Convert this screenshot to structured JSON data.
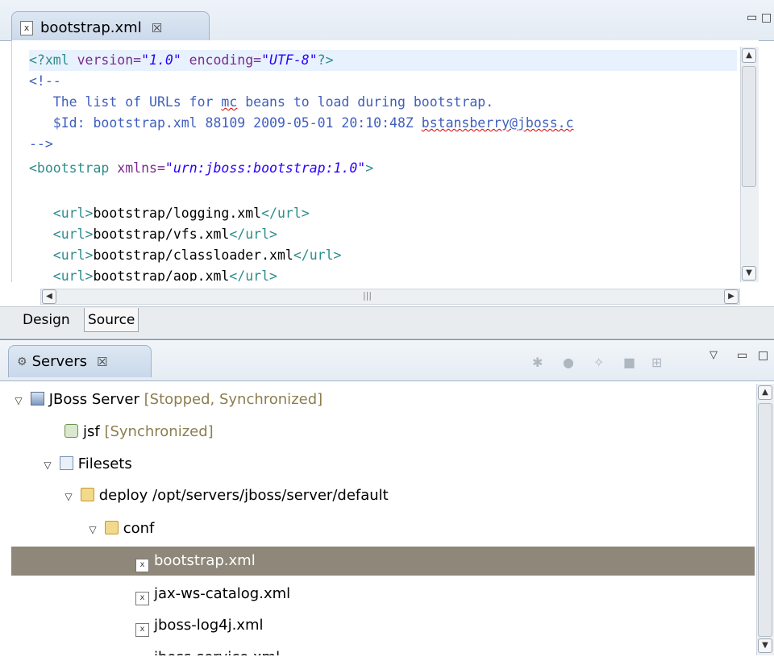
{
  "editor": {
    "tab_title": "bootstrap.xml",
    "tab_icon": "x",
    "close_glyph": "☒",
    "lines": {
      "l1_decl_open": "<?xml",
      "l1_version_attr": " version=",
      "l1_version_val": "\"1.0\"",
      "l1_encoding_attr": " encoding=",
      "l1_encoding_val": "\"UTF-8\"",
      "l1_decl_close": "?>",
      "l2": "<!--",
      "l3_a": "   The list of URLs for ",
      "l3_b": "mc",
      "l3_c": " beans to load during bootstrap.",
      "l4_a": "   $Id: bootstrap.xml 88109 2009-05-01 20:10:48Z ",
      "l4_b": "bstansberry@jboss.c",
      "l5": "-->",
      "l6_open": "<bootstrap",
      "l6_attr": " xmlns=",
      "l6_val": "\"urn:jboss:bootstrap:1.0\"",
      "l6_close": ">",
      "l7_open": "   <url>",
      "l7_text": "bootstrap/logging.xml",
      "l7_close": "</url>",
      "l8_open": "   <url>",
      "l8_text": "bootstrap/vfs.xml",
      "l8_close": "</url>",
      "l9_open": "   <url>",
      "l9_text": "bootstrap/classloader.xml",
      "l9_close": "</url>",
      "l10_open": "   <url>",
      "l10_text": "bootstrap/aop.xml",
      "l10_close": "</url>"
    },
    "bottom_tabs": [
      "Design",
      "Source"
    ]
  },
  "servers": {
    "tab_title": "Servers",
    "tree": [
      {
        "label": "JBoss Server",
        "status": "[Stopped, Synchronized]",
        "icon": "server-icon"
      },
      {
        "label": "jsf",
        "status": "[Synchronized]",
        "icon": "module-icon"
      },
      {
        "label": "Filesets",
        "status": "",
        "icon": "filesets-icon"
      },
      {
        "label": "deploy  /opt/servers/jboss/server/default",
        "status": "",
        "icon": "folder-icon"
      },
      {
        "label": "conf",
        "status": "",
        "icon": "folder-icon"
      },
      {
        "label": "bootstrap.xml",
        "status": "",
        "icon": "xml-file-icon"
      },
      {
        "label": "jax-ws-catalog.xml",
        "status": "",
        "icon": "xml-file-icon"
      },
      {
        "label": "jboss-log4j.xml",
        "status": "",
        "icon": "xml-file-icon"
      },
      {
        "label": "jboss-service.xml",
        "status": "",
        "icon": "xml-file-icon"
      }
    ]
  },
  "colors": {
    "selection": "#8e877a",
    "tag": "#2e8c8c",
    "attribute": "#7b2a8f",
    "value": "#2a00ff",
    "comment": "#3f5fbf"
  }
}
